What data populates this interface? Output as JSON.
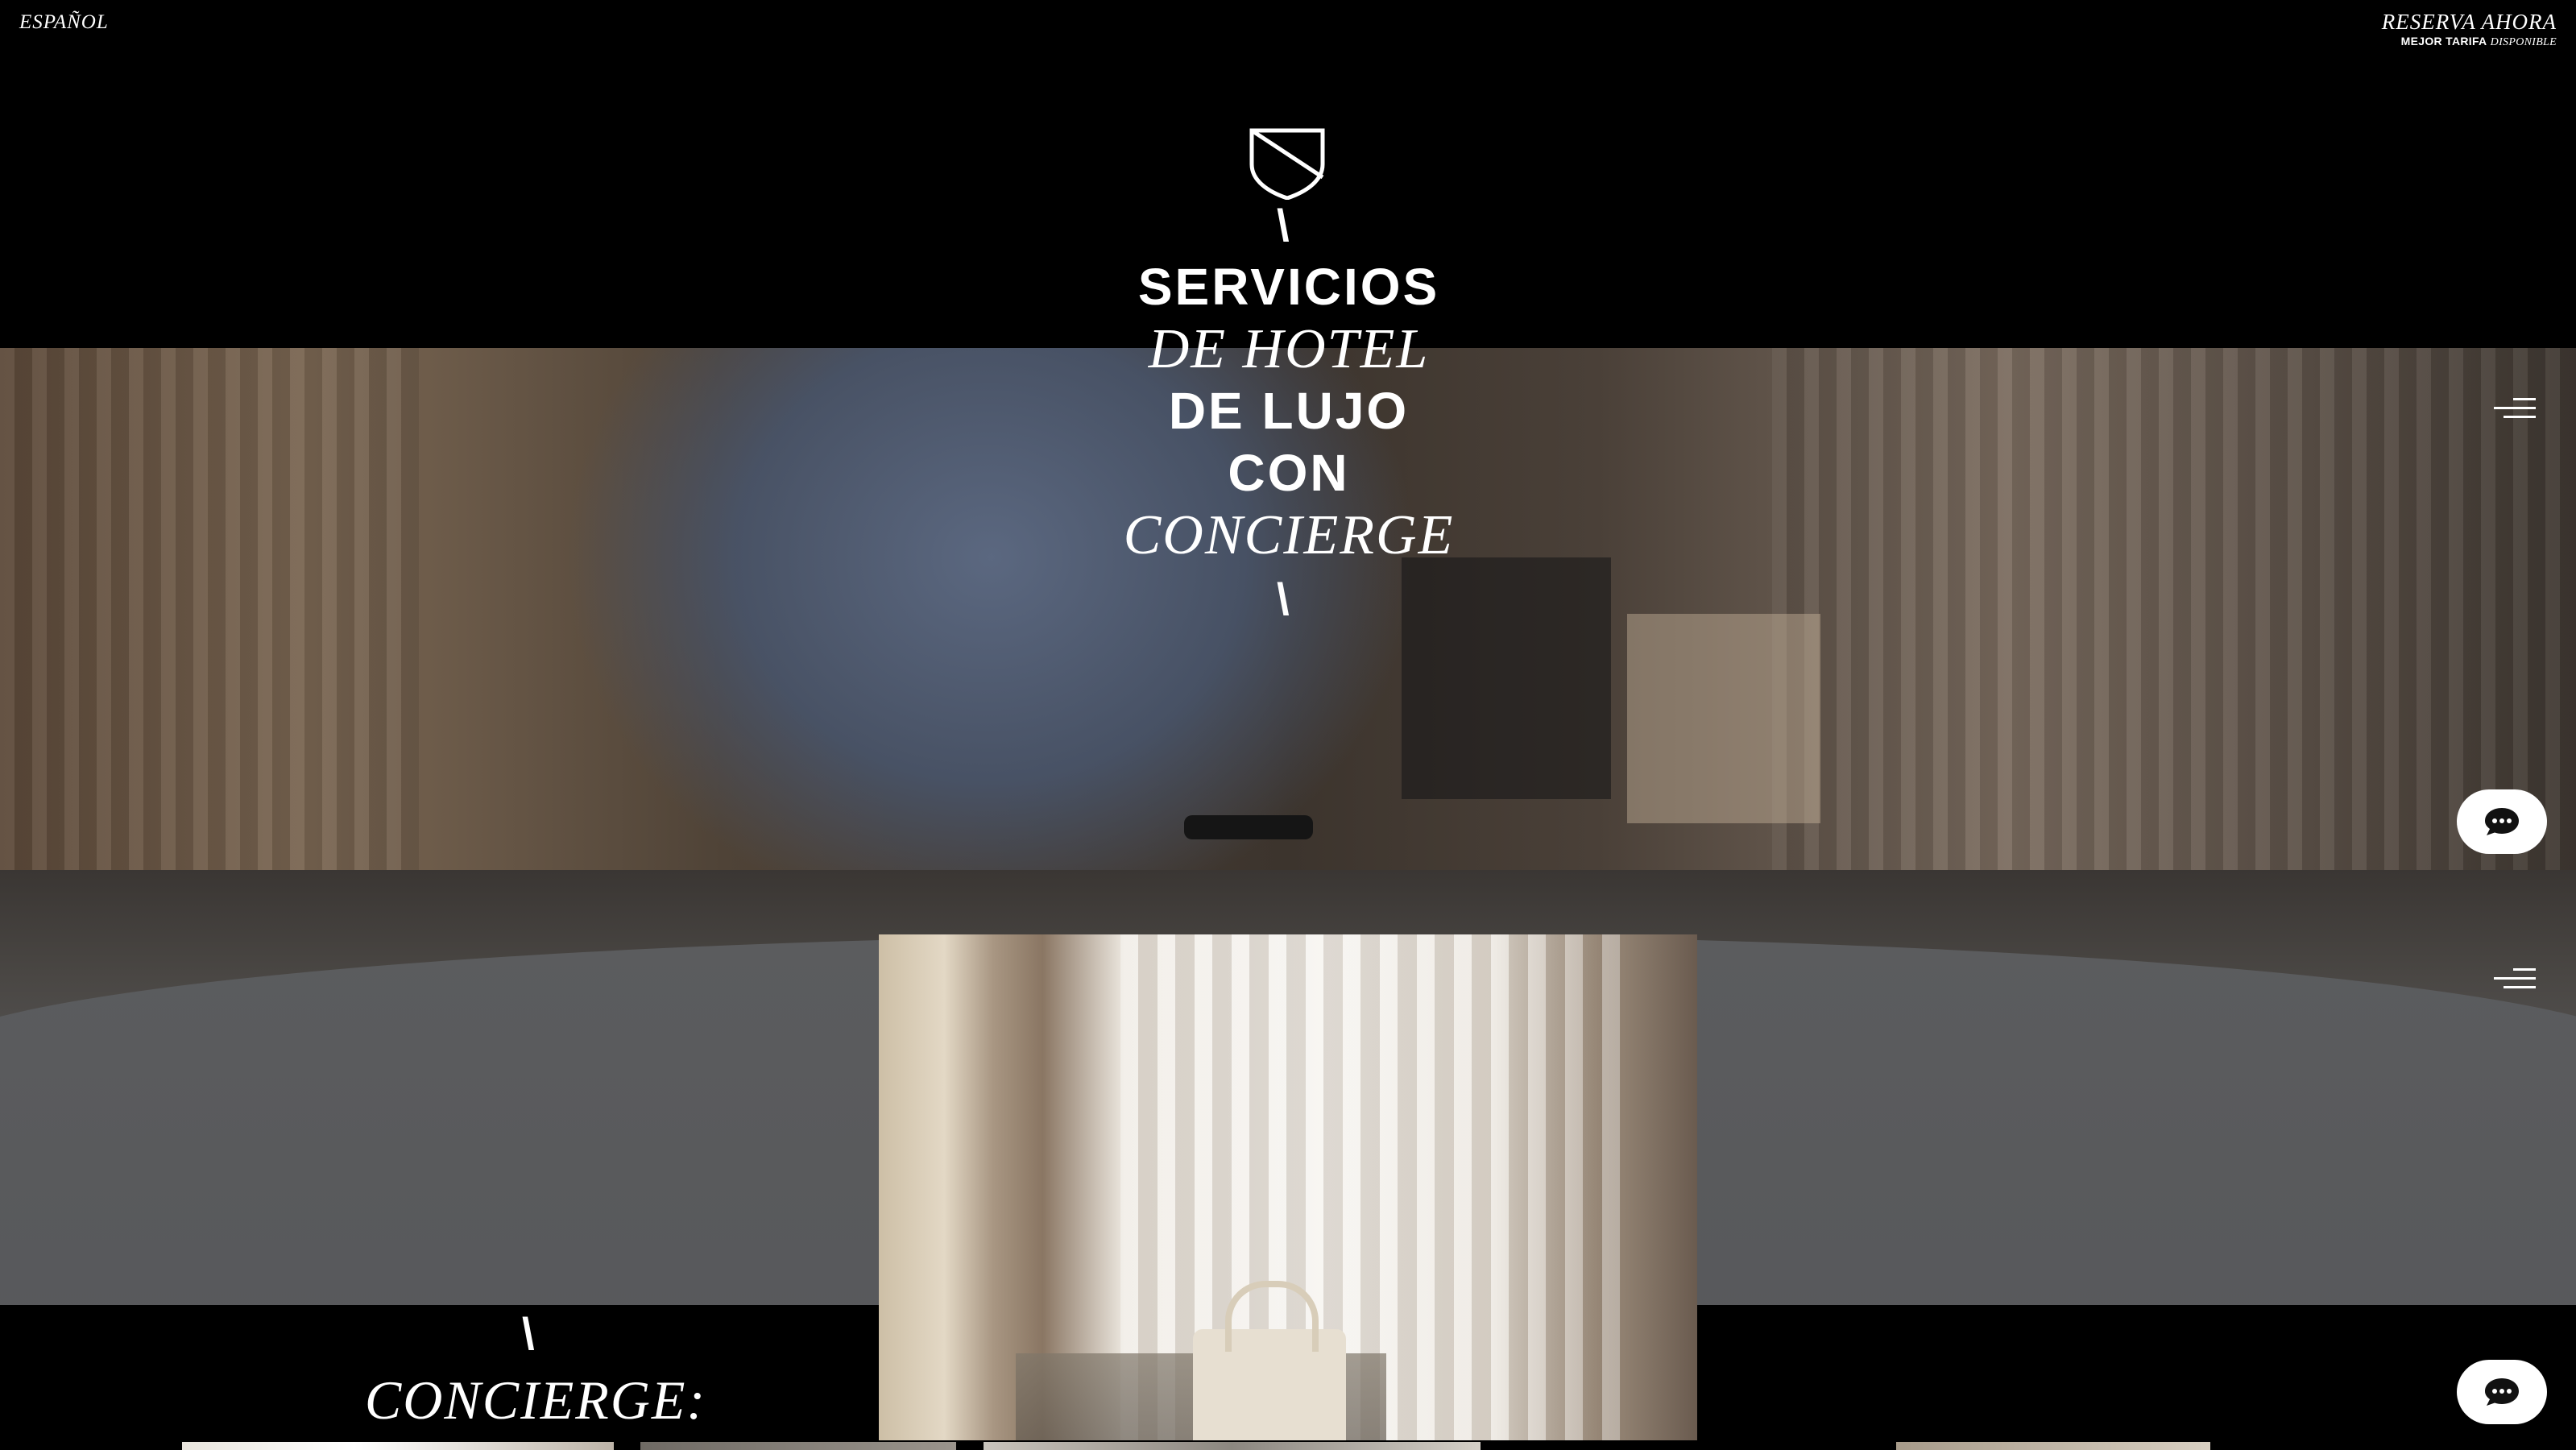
{
  "topbar": {
    "language": "ESPAÑOL",
    "booking_title": "RESERVA AHORA",
    "booking_sub_bold": "MEJOR TARIFA",
    "booking_sub_italic": "DISPONIBLE"
  },
  "hero": {
    "separator": "\\",
    "lines": [
      {
        "text": "SERVICIOS",
        "style": "sans"
      },
      {
        "text": "DE HOTEL",
        "style": "serif"
      },
      {
        "text": "DE LUJO",
        "style": "sans"
      },
      {
        "text": "CON",
        "style": "sans"
      },
      {
        "text": "CONCIERGE",
        "style": "serif"
      }
    ]
  },
  "section": {
    "separator": "\\",
    "title": "CONCIERGE:"
  },
  "icons": {
    "logo": "shield-logo",
    "menu": "hamburger-menu-icon",
    "chat": "chat-bubble-icon"
  },
  "colors": {
    "background": "#000000",
    "text": "#ffffff",
    "band": "#555556"
  }
}
